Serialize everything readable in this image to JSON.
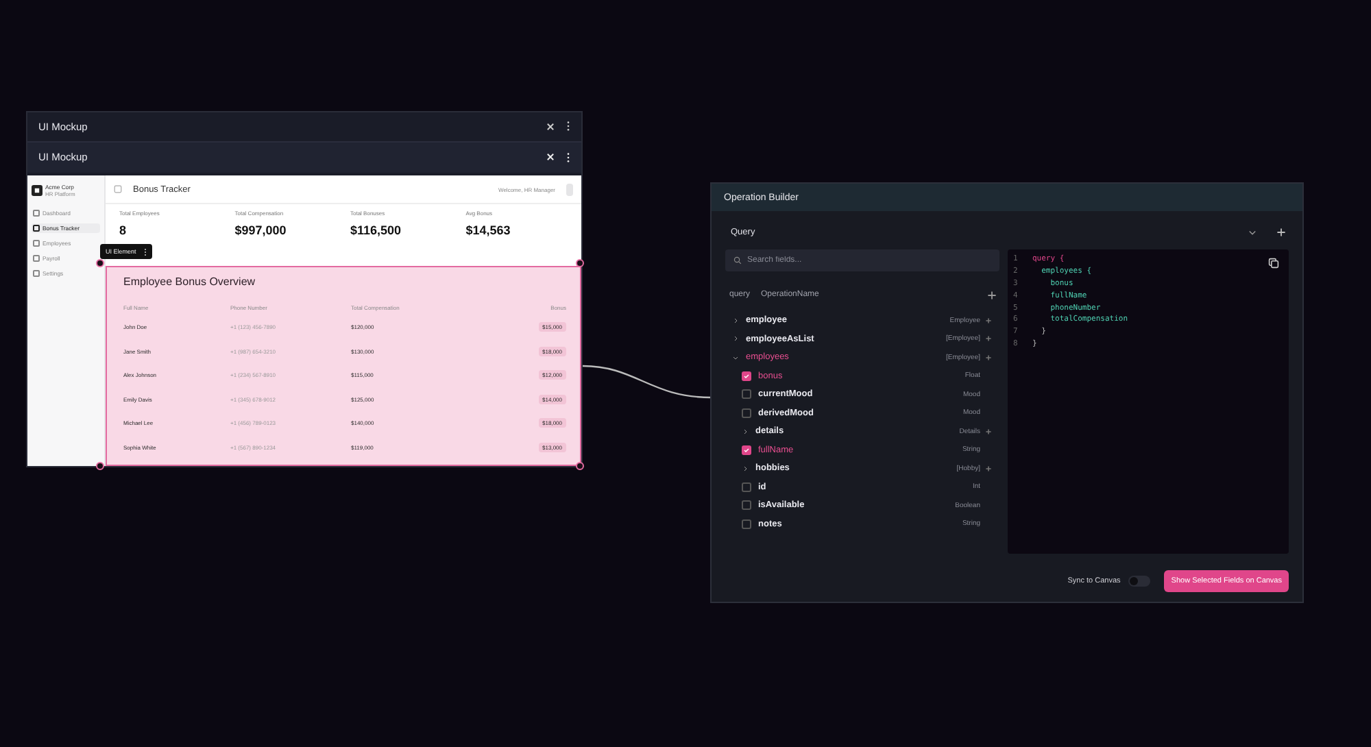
{
  "mockup_window": {
    "title": "UI Mockup",
    "inner_title": "UI Mockup"
  },
  "app": {
    "brand": "Acme Corp",
    "brand_subtitle": "HR Platform",
    "page_title": "Bonus Tracker",
    "welcome": "Welcome, HR Manager",
    "nav": [
      {
        "label": "Dashboard",
        "selected": false
      },
      {
        "label": "Bonus Tracker",
        "selected": true
      },
      {
        "label": "Employees",
        "selected": false
      },
      {
        "label": "Payroll",
        "selected": false
      },
      {
        "label": "Settings",
        "selected": false
      }
    ],
    "stats": [
      {
        "label": "Total Employees",
        "value": "8"
      },
      {
        "label": "Total Compensation",
        "value": "$997,000"
      },
      {
        "label": "Total Bonuses",
        "value": "$116,500"
      },
      {
        "label": "Avg Bonus",
        "value": "$14,563"
      }
    ],
    "selection_tag": "UI Element",
    "table": {
      "title": "Employee Bonus Overview",
      "columns": [
        "Full Name",
        "Phone Number",
        "Total Compensation",
        "Bonus"
      ],
      "rows": [
        [
          "John Doe",
          "+1 (123) 456-7890",
          "$120,000",
          "$15,000"
        ],
        [
          "Jane Smith",
          "+1 (987) 654-3210",
          "$130,000",
          "$18,000"
        ],
        [
          "Alex Johnson",
          "+1 (234) 567-8910",
          "$115,000",
          "$12,000"
        ],
        [
          "Emily Davis",
          "+1 (345) 678-9012",
          "$125,000",
          "$14,000"
        ],
        [
          "Michael Lee",
          "+1 (456) 789-0123",
          "$140,000",
          "$18,000"
        ],
        [
          "Sophia White",
          "+1 (567) 890-1234",
          "$119,000",
          "$13,000"
        ]
      ]
    }
  },
  "operation_builder": {
    "title": "Operation Builder",
    "operation_type": "Query",
    "search": {
      "placeholder": "Search fields..."
    },
    "operation_tabs": [
      "query",
      "OperationName"
    ],
    "fields": [
      {
        "kind": "object",
        "name": "employee",
        "type": "Employee",
        "expanded": false
      },
      {
        "kind": "object",
        "name": "employeeAsList",
        "type": "[Employee]",
        "expanded": false
      },
      {
        "kind": "object",
        "name": "employees",
        "type": "[Employee]",
        "expanded": true,
        "children": [
          {
            "kind": "field",
            "name": "bonus",
            "type": "Float",
            "checked": true
          },
          {
            "kind": "field",
            "name": "currentMood",
            "type": "Mood",
            "checked": false
          },
          {
            "kind": "field",
            "name": "derivedMood",
            "type": "Mood",
            "checked": false
          },
          {
            "kind": "object",
            "name": "details",
            "type": "Details",
            "expanded": false
          },
          {
            "kind": "field",
            "name": "fullName",
            "type": "String",
            "checked": true
          },
          {
            "kind": "object",
            "name": "hobbies",
            "type": "[Hobby]",
            "expanded": false
          },
          {
            "kind": "field",
            "name": "id",
            "type": "Int",
            "checked": false
          },
          {
            "kind": "field",
            "name": "isAvailable",
            "type": "Boolean",
            "checked": false
          },
          {
            "kind": "field",
            "name": "notes",
            "type": "String",
            "checked": false
          }
        ]
      }
    ],
    "code": [
      {
        "number": "1",
        "text": "query {",
        "kind": "keyword"
      },
      {
        "number": "2",
        "text": "  employees {",
        "kind": "field"
      },
      {
        "number": "3",
        "text": "    bonus",
        "kind": "field"
      },
      {
        "number": "4",
        "text": "    fullName",
        "kind": "field"
      },
      {
        "number": "5",
        "text": "    phoneNumber",
        "kind": "field"
      },
      {
        "number": "6",
        "text": "    totalCompensation",
        "kind": "field"
      },
      {
        "number": "7",
        "text": "  }",
        "kind": "brace"
      },
      {
        "number": "8",
        "text": "}",
        "kind": "brace"
      }
    ],
    "sync": {
      "label": "Sync to Canvas",
      "on": false
    },
    "button": "Show Selected Fields on Canvas"
  }
}
